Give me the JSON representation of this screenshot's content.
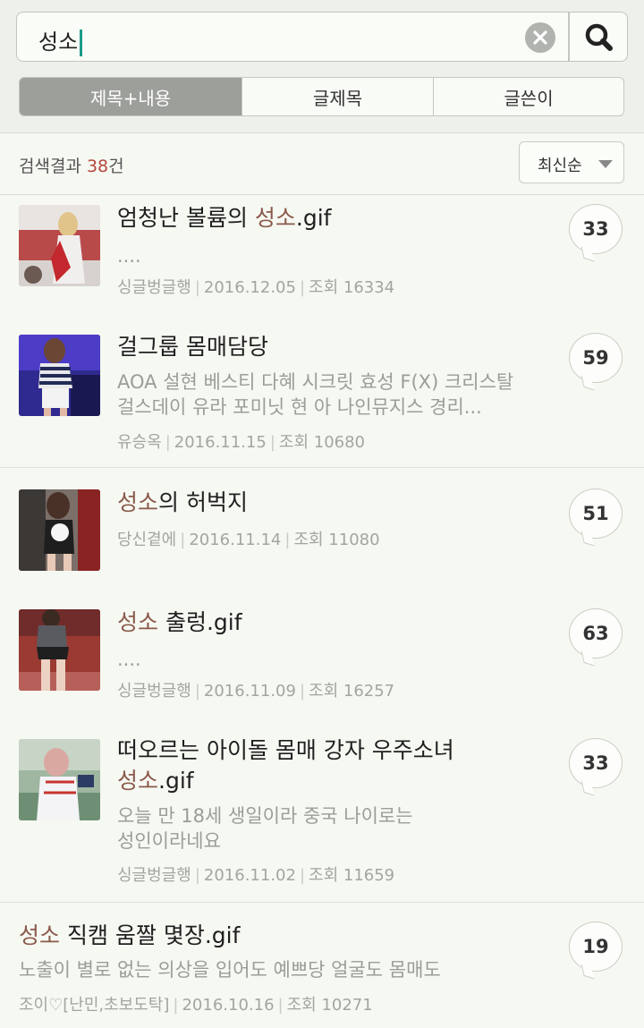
{
  "search": {
    "query": "성소"
  },
  "tabs": [
    {
      "label": "제목+내용"
    },
    {
      "label": "글제목"
    },
    {
      "label": "글쓴이"
    }
  ],
  "results": {
    "prefix": "검색결과 ",
    "count": "38",
    "suffix": "건"
  },
  "sort": {
    "label": "최신순"
  },
  "posts": [
    {
      "title_pre": "엄청난 볼륨의 ",
      "title_hl": "성소",
      "title_post": ".gif",
      "title_line2_hl": "",
      "title_line2_post": "",
      "preview1": "....",
      "preview2": "",
      "author": "싱글벙글행",
      "date": "2016.12.05",
      "views": "조회 16334",
      "comments": "33"
    },
    {
      "title_pre": "걸그룹 몸매담당",
      "title_hl": "",
      "title_post": "",
      "title_line2_hl": "",
      "title_line2_post": "",
      "preview1": "AOA 설현 베스티 다혜 시크릿 효성 F(X) 크리스탈",
      "preview2": "걸스데이 유라 포미닛 현 아 나인뮤지스 경리...",
      "author": "유승옥",
      "date": "2016.11.15",
      "views": "조회 10680",
      "comments": "59"
    },
    {
      "title_pre": "",
      "title_hl": "성소",
      "title_post": "의 허벅지",
      "title_line2_hl": "",
      "title_line2_post": "",
      "preview1": "",
      "preview2": "",
      "author": "당신곁에",
      "date": "2016.11.14",
      "views": "조회 11080",
      "comments": "51"
    },
    {
      "title_pre": "",
      "title_hl": "성소",
      "title_post": " 출렁.gif",
      "title_line2_hl": "",
      "title_line2_post": "",
      "preview1": "....",
      "preview2": "",
      "author": "싱글벙글행",
      "date": "2016.11.09",
      "views": "조회 16257",
      "comments": "63"
    },
    {
      "title_pre": "떠오르는 아이돌 몸매 강자 우주소녀",
      "title_hl": "",
      "title_post": "",
      "title_line2_hl": "성소",
      "title_line2_post": ".gif",
      "preview1": "오늘 만 18세 생일이라 중국 나이로는",
      "preview2": "성인이라네요",
      "author": "싱글벙글행",
      "date": "2016.11.02",
      "views": "조회 11659",
      "comments": "33"
    },
    {
      "title_pre": "",
      "title_hl": "성소",
      "title_post": " 직캠 움짤 몇장.gif",
      "title_line2_hl": "",
      "title_line2_post": "",
      "preview1": "노출이 별로 없는 의상을 입어도 예쁘당 얼굴도 몸매도",
      "preview2": "",
      "author": "조이♡[난민,초보도탁]",
      "date": "2016.10.16",
      "views": "조회 10271",
      "comments": "19"
    }
  ]
}
